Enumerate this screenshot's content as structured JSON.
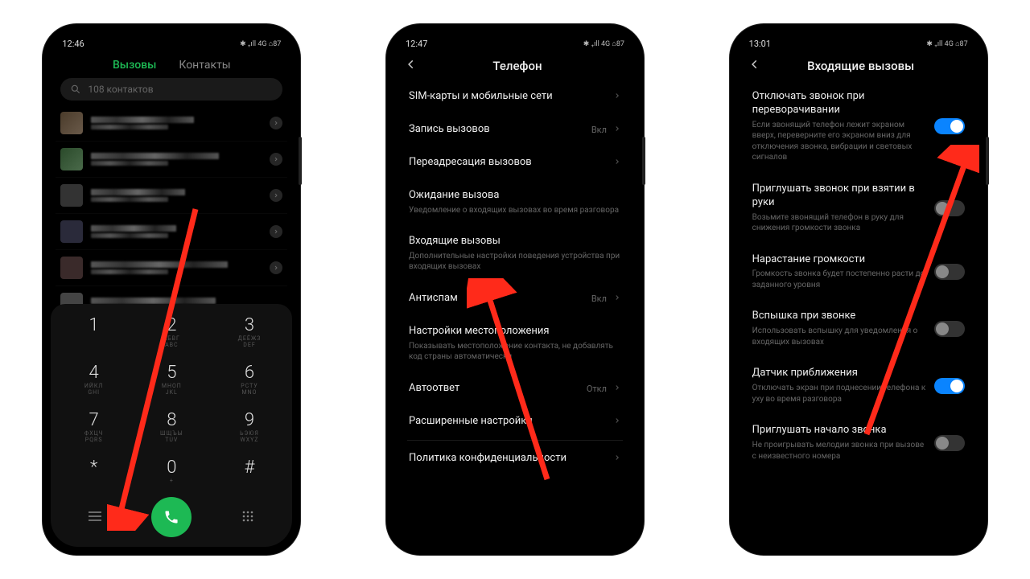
{
  "phone1": {
    "time": "12:46",
    "status": "✱ ₊ıll 4G ⌂87",
    "tabs": {
      "calls": "Вызовы",
      "contacts": "Контакты"
    },
    "search_placeholder": "108 контактов",
    "keys": [
      {
        "n": "1",
        "s": ""
      },
      {
        "n": "2",
        "s": "АБВГ\nABC"
      },
      {
        "n": "3",
        "s": "ДЕЁЖЗ\nDEF"
      },
      {
        "n": "4",
        "s": "ИЙКЛ\nGHI"
      },
      {
        "n": "5",
        "s": "МНОП\nJKL"
      },
      {
        "n": "6",
        "s": "РСТУ\nMNO"
      },
      {
        "n": "7",
        "s": "ФХЦЧ\nPQRS"
      },
      {
        "n": "8",
        "s": "ШЩЪЫ\nTUV"
      },
      {
        "n": "9",
        "s": "ЬЭЮЯ\nWXYZ"
      },
      {
        "n": "*",
        "s": ""
      },
      {
        "n": "0",
        "s": "+"
      },
      {
        "n": "#",
        "s": ""
      }
    ]
  },
  "phone2": {
    "time": "12:47",
    "status": "✱ ₊ıll 4G ⌂87",
    "title": "Телефон",
    "items": [
      {
        "main": "SIM-карты и мобильные сети",
        "desc": "",
        "val": "",
        "arr": true
      },
      {
        "main": "Запись вызовов",
        "desc": "",
        "val": "Вкл",
        "arr": true
      },
      {
        "main": "Переадресация вызовов",
        "desc": "",
        "val": "",
        "arr": true
      },
      {
        "main": "Ожидание вызова",
        "desc": "Уведомление о входящих вызовах во время разговора",
        "val": "",
        "arr": false
      },
      {
        "main": "Входящие вызовы",
        "desc": "Дополнительные настройки поведения устройства при входящих вызовах",
        "val": "",
        "arr": false
      },
      {
        "main": "Антиспам",
        "desc": "",
        "val": "Вкл",
        "arr": true
      },
      {
        "main": "Настройки местоположения",
        "desc": "Показывать местоположение контакта, не добавлять код страны автоматически",
        "val": "",
        "arr": false
      },
      {
        "main": "Автоответ",
        "desc": "",
        "val": "Откл",
        "arr": true
      },
      {
        "main": "Расширенные настройки",
        "desc": "",
        "val": "",
        "arr": true
      },
      {
        "main": "Политика конфиденциальности",
        "desc": "",
        "val": "",
        "arr": true
      }
    ]
  },
  "phone3": {
    "time": "13:01",
    "status": "✱ ₊ıll 4G ⌂87",
    "title": "Входящие вызовы",
    "items": [
      {
        "main": "Отключать звонок при переворачивании",
        "desc": "Если звонящий телефон лежит экраном вверх, переверните его экраном вниз для отключения звонка, вибрации и световых сигналов",
        "on": true
      },
      {
        "main": "Приглушать звонок при взятии в руки",
        "desc": "Возьмите звонящий телефон в руку для снижения громкости звонка",
        "on": false
      },
      {
        "main": "Нарастание громкости",
        "desc": "Громкость звонка будет постепенно расти до заданного уровня",
        "on": false
      },
      {
        "main": "Вспышка при звонке",
        "desc": "Использовать вспышку для уведомления о входящих вызовах",
        "on": false
      },
      {
        "main": "Датчик приближения",
        "desc": "Отключать экран при поднесении телефона к уху во время разговора",
        "on": true
      },
      {
        "main": "Приглушать начало звонка",
        "desc": "Не проигрывать мелодии звонка при вызове с неизвестного номера",
        "on": false
      }
    ]
  }
}
